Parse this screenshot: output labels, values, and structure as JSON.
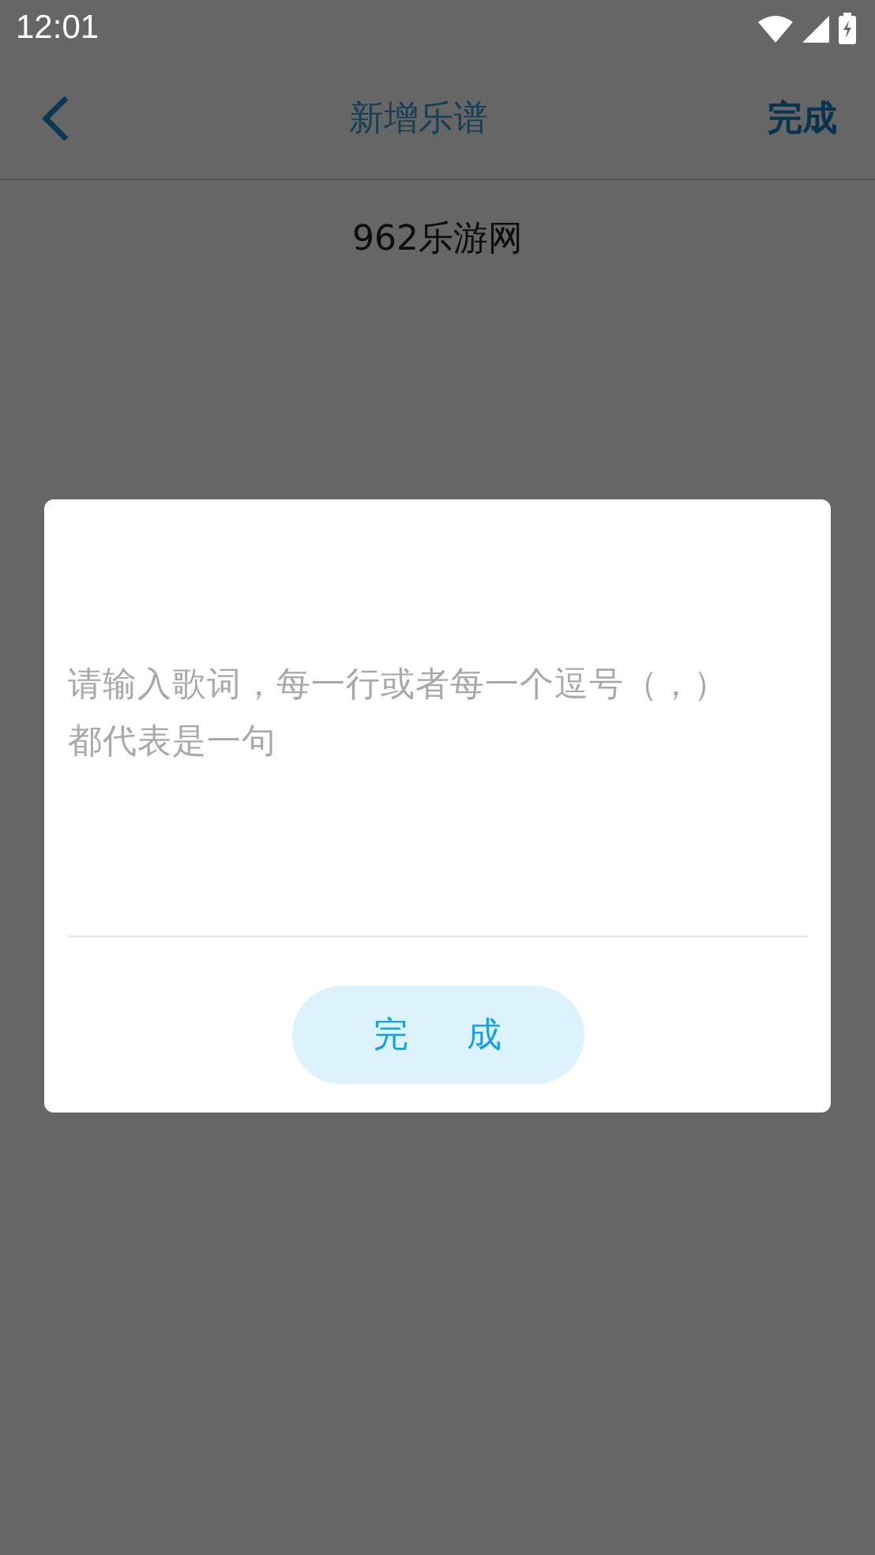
{
  "status_bar": {
    "time": "12:01"
  },
  "app_bar": {
    "title": "新增乐谱",
    "action": "完成"
  },
  "score_name": "962乐游网",
  "dialog": {
    "lyrics_field": {
      "placeholder": "请输入歌词，每一行或者每一个逗号（，）都代表是一句"
    },
    "button": "完成"
  }
}
